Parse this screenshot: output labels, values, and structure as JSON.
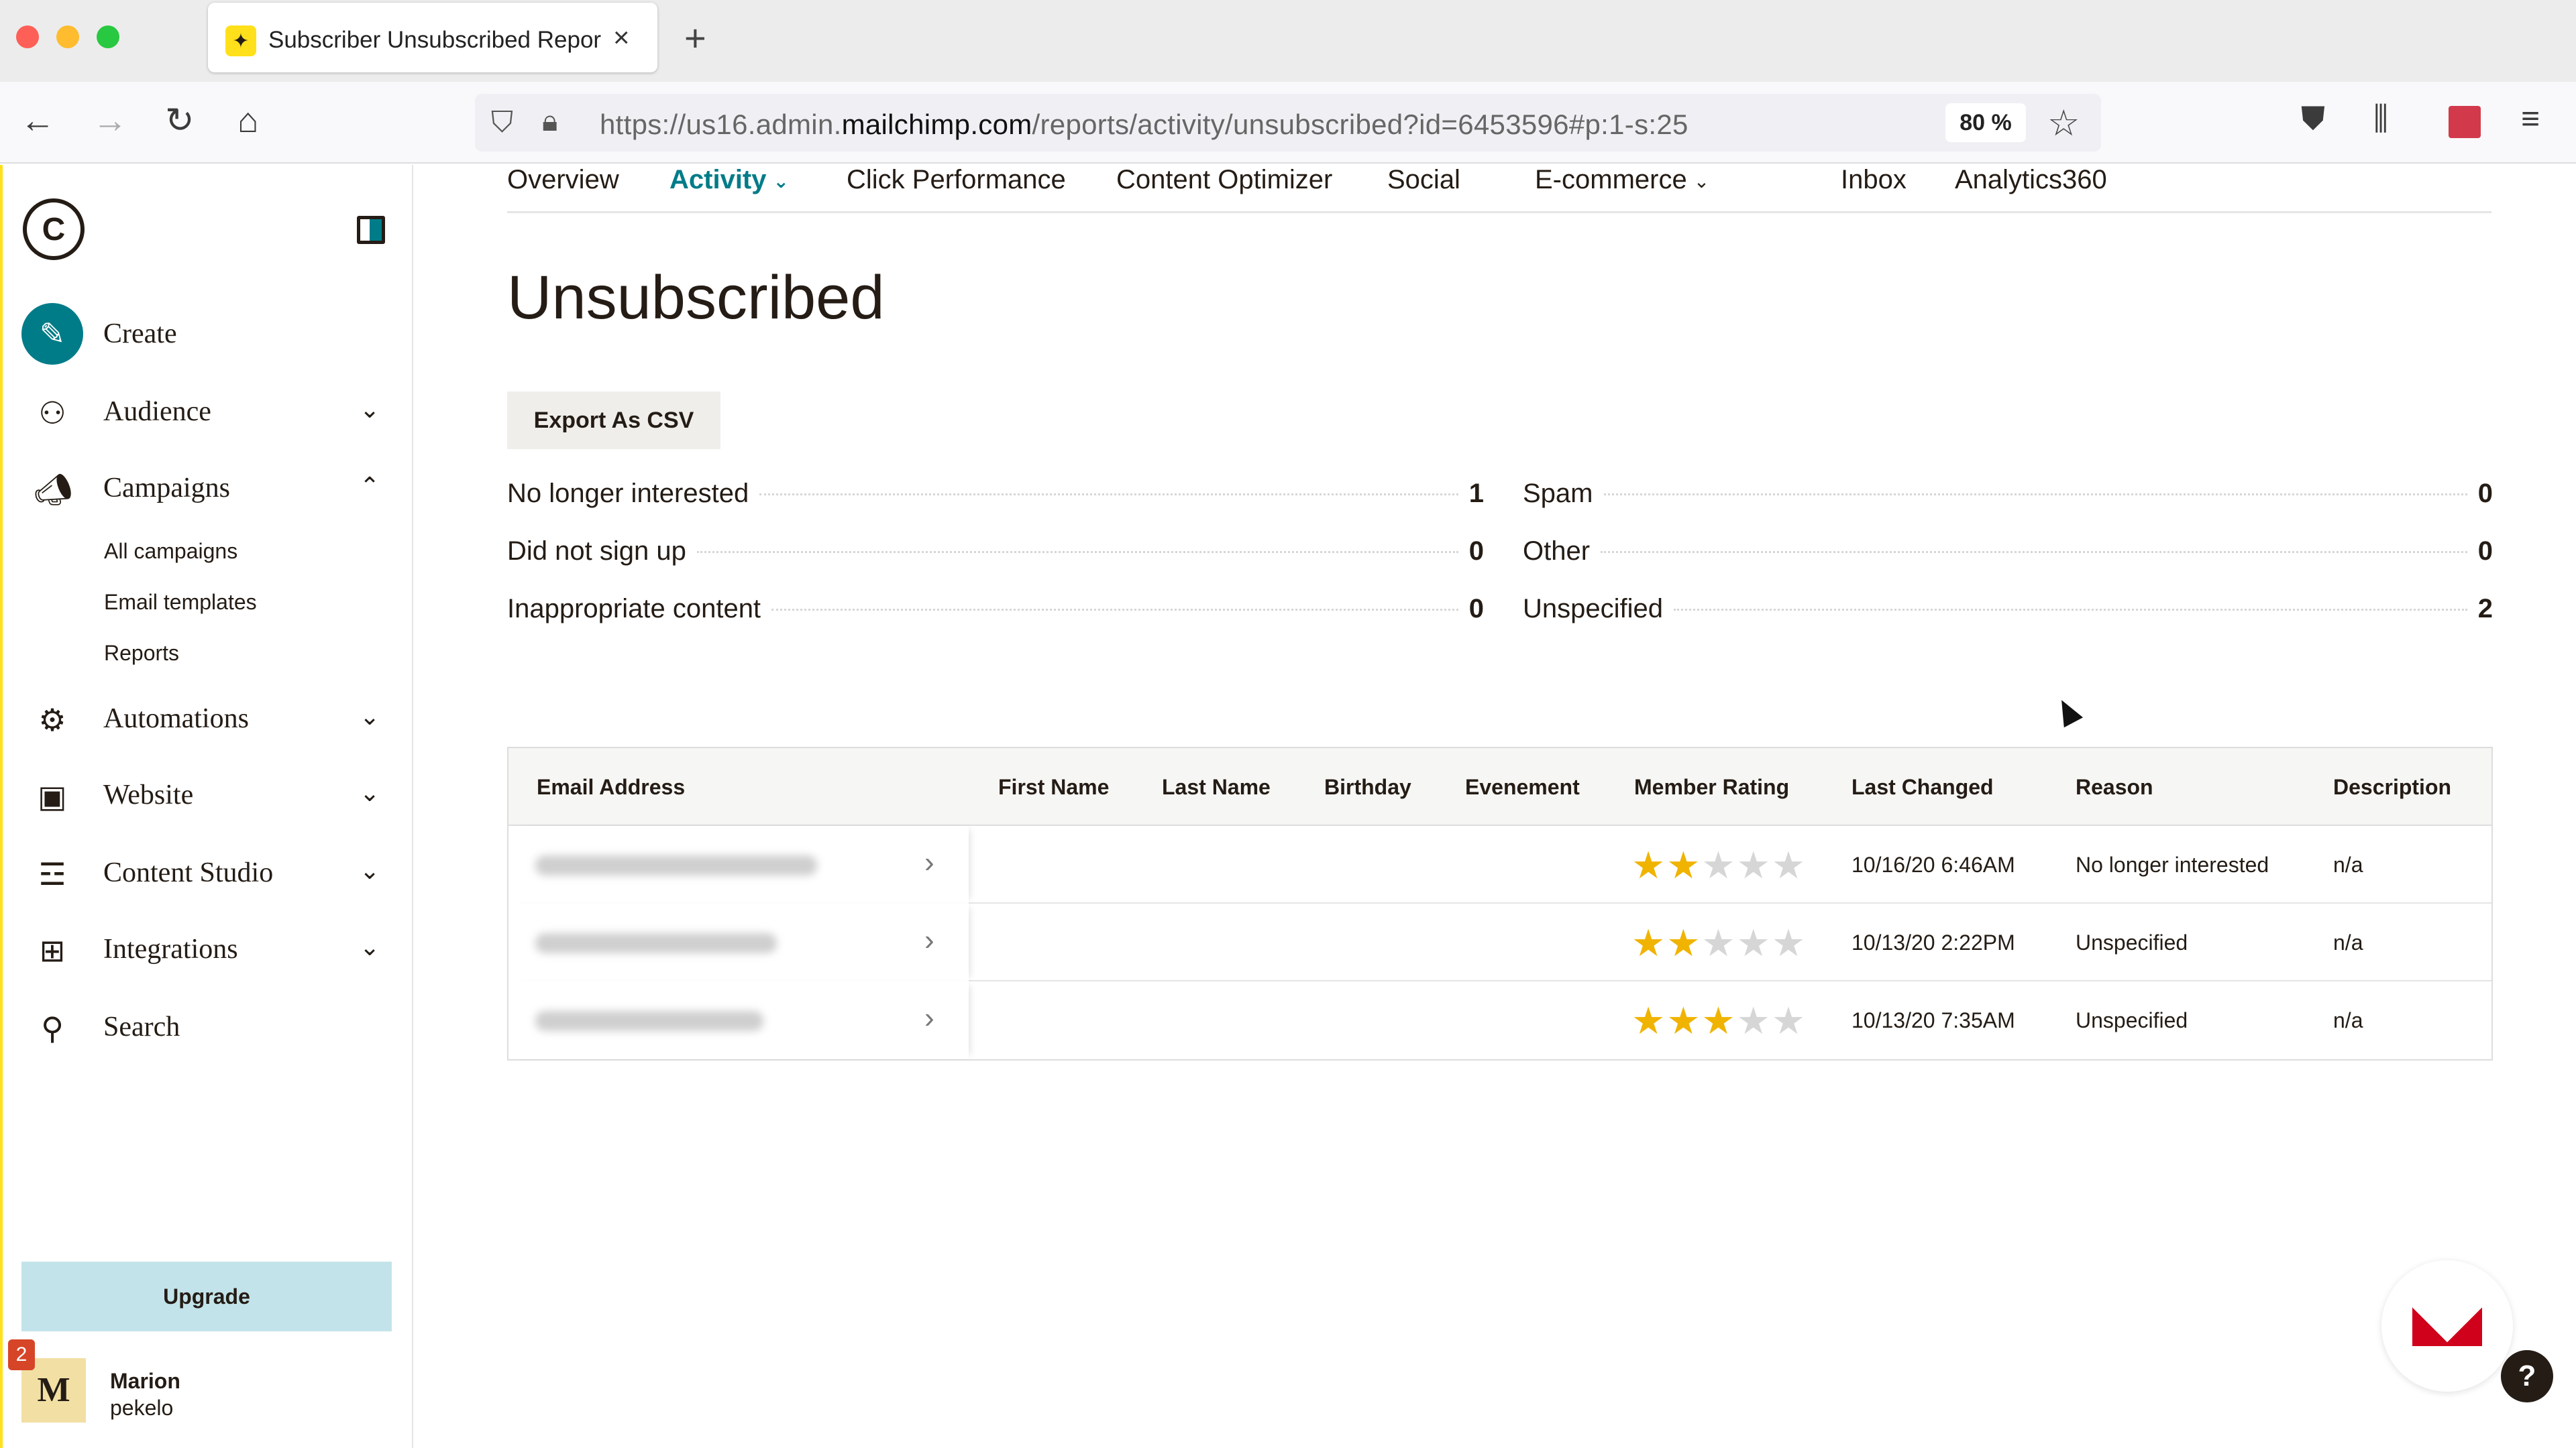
{
  "browser": {
    "tab_title": "Subscriber Unsubscribed Repor",
    "tab_close": "×",
    "new_tab": "+",
    "url_prefix": "https://us16.admin.",
    "url_host": "mailchimp.com",
    "url_path": "/reports/activity/unsubscribed?id=6453596#p:1-s:25",
    "zoom": "80 %"
  },
  "sidebar": {
    "create_label": "Create",
    "items": [
      {
        "label": "Audience",
        "icon": "audience-icon"
      },
      {
        "label": "Campaigns",
        "icon": "campaigns-icon"
      },
      {
        "label": "Automations",
        "icon": "automations-icon"
      },
      {
        "label": "Website",
        "icon": "website-icon"
      },
      {
        "label": "Content Studio",
        "icon": "content-studio-icon"
      },
      {
        "label": "Integrations",
        "icon": "integrations-icon"
      },
      {
        "label": "Search",
        "icon": "search-icon"
      }
    ],
    "campaign_subitems": [
      "All campaigns",
      "Email templates",
      "Reports"
    ],
    "upgrade_label": "Upgrade",
    "user": {
      "initial": "M",
      "badge": "2",
      "name": "Marion",
      "org": "pekelo"
    }
  },
  "subnav": {
    "items": [
      "Overview",
      "Activity",
      "Click Performance",
      "Content Optimizer",
      "Social",
      "E-commerce",
      "Inbox",
      "Analytics360"
    ],
    "active": "Activity"
  },
  "page": {
    "title": "Unsubscribed",
    "export_label": "Export As CSV"
  },
  "stats": {
    "left": [
      {
        "label": "No longer interested",
        "value": "1"
      },
      {
        "label": "Did not sign up",
        "value": "0"
      },
      {
        "label": "Inappropriate content",
        "value": "0"
      }
    ],
    "right": [
      {
        "label": "Spam",
        "value": "0"
      },
      {
        "label": "Other",
        "value": "0"
      },
      {
        "label": "Unspecified",
        "value": "2"
      }
    ]
  },
  "table": {
    "headers": [
      "Email Address",
      "First Name",
      "Last Name",
      "Birthday",
      "Evenement",
      "Member Rating",
      "Last Changed",
      "Reason",
      "Description"
    ],
    "rows": [
      {
        "rating": 2,
        "last_changed": "10/16/20 6:46AM",
        "reason": "No longer interested",
        "description": "n/a"
      },
      {
        "rating": 2,
        "last_changed": "10/13/20 2:22PM",
        "reason": "Unspecified",
        "description": "n/a"
      },
      {
        "rating": 3,
        "last_changed": "10/13/20 7:35AM",
        "reason": "Unspecified",
        "description": "n/a"
      }
    ]
  },
  "colors": {
    "accent": "#007c89",
    "star": "#f0b300",
    "brand_yellow": "#ffe01b"
  }
}
